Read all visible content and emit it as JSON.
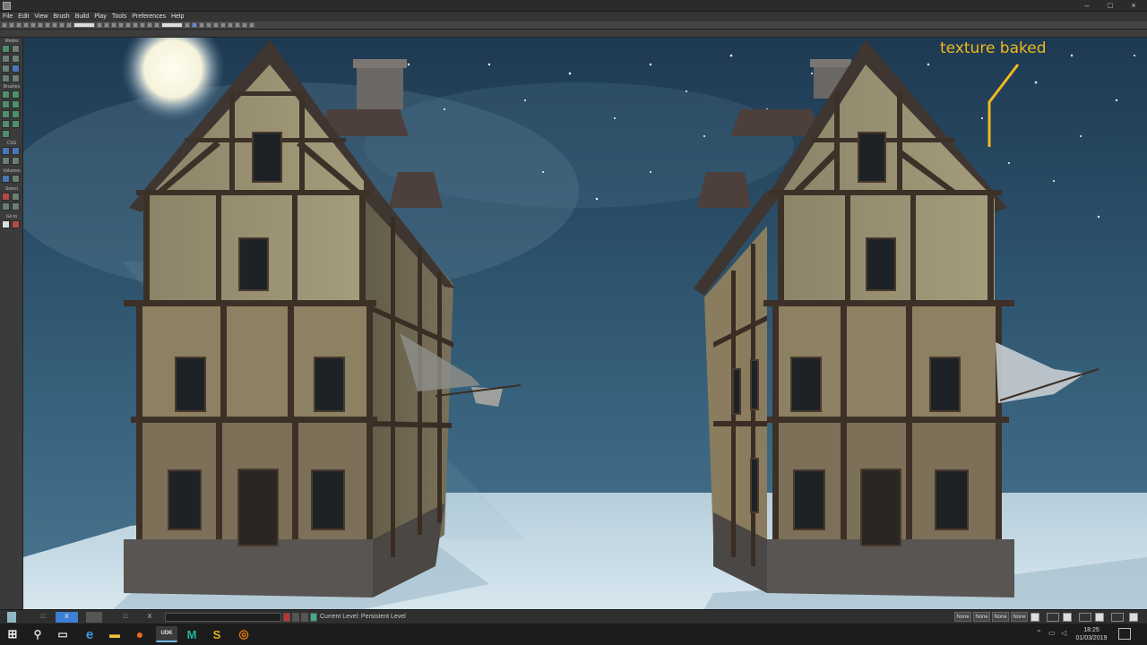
{
  "menu": [
    "File",
    "Edit",
    "View",
    "Brush",
    "Build",
    "Play",
    "Tools",
    "Preferences",
    "Help"
  ],
  "window_controls": {
    "minimize": "–",
    "maximize": "□",
    "close": "×"
  },
  "left_panel": {
    "groups": [
      "Modes",
      "Brushes",
      "CSG",
      "Volumes",
      "Select",
      "Go to"
    ]
  },
  "viewport": {
    "annotation": "texture baked",
    "sky_color": "#2d526c",
    "annotation_color": "#f2b81e"
  },
  "statusbar": {
    "tabs": [
      "□",
      "X",
      "□",
      "X"
    ],
    "current_level": "Current Level:  Persistent Level",
    "none_buttons": [
      "None",
      "None",
      "None",
      "None"
    ]
  },
  "taskbar": {
    "apps": [
      {
        "icon": "windows-start-icon",
        "glyph": "⊞"
      },
      {
        "icon": "search-icon",
        "glyph": "⚲"
      },
      {
        "icon": "task-view-icon",
        "glyph": "▭"
      },
      {
        "icon": "edge-icon",
        "glyph": "e"
      },
      {
        "icon": "file-explorer-icon",
        "glyph": "▬"
      },
      {
        "icon": "firefox-icon",
        "glyph": "●"
      },
      {
        "icon": "udk-icon",
        "glyph": "UDK"
      },
      {
        "icon": "maya-icon",
        "glyph": "M"
      },
      {
        "icon": "substance-icon",
        "glyph": "S"
      },
      {
        "icon": "blender-icon",
        "glyph": "◎"
      }
    ],
    "time": "18:25",
    "date": "01/03/2019"
  }
}
